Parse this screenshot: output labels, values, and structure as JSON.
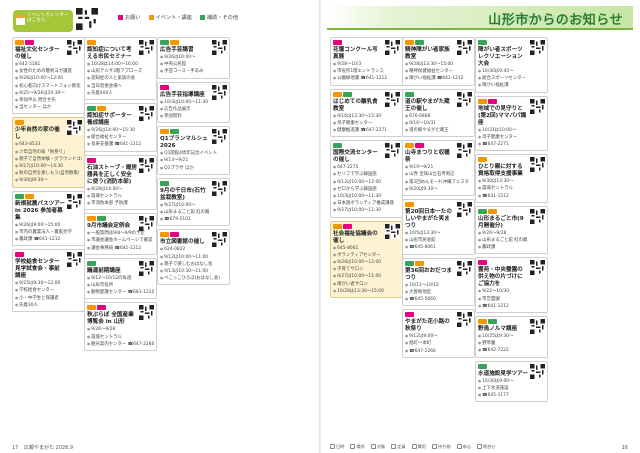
{
  "header": {
    "calendar_pill": "イベントカレンダーはこちら",
    "legend": [
      {
        "label": "お願い",
        "color": "#e4007f"
      },
      {
        "label": "イベント・講座",
        "color": "#f39800"
      },
      {
        "label": "補助・その他",
        "color": "#3aa35a"
      }
    ],
    "title": "山形市からのお知らせ"
  },
  "columns": [
    [
      {
        "title": "福祉文化センターの催し",
        "lines": [
          "642-5181",
          "女性のための簡易ヨガ講座",
          "9/26は10:00〜12:00",
          "初心者向けスマートフォン教室",
          "9/25〜9/26は10:30〜",
          "参加申込 問合せ先",
          "当センター ほか"
        ],
        "hl": false
      },
      {
        "title": "少年自然の家の催し",
        "lines": [
          "643-8533",
          "少年自然の家「秋祭り」",
          "親子で自然体験・グラウンドゴルフ",
          "9/27は10:00〜14:30",
          "秋の自然を楽しもう(自然散策)",
          "9/30は9:30〜"
        ],
        "hl": true
      },
      {
        "title": "新規就農パスツアー in 2026 参加者募集",
        "lines": [
          "9/26は9:00〜15:00",
          "市内の農業法人・農家見学",
          "農政課 ☎641-1212"
        ],
        "hl": false
      },
      {
        "title": "学校給食センター見学試食会・事前講座",
        "lines": [
          "9/25は9:30〜12:00",
          "学校給食センター",
          "小・中学生と保護者",
          "先着30人"
        ],
        "hl": false
      }
    ],
    [
      {
        "title": "認知症について考える市民セミナー",
        "lines": [
          "10/28は14:00〜16:00",
          "山形テルサ3階アプローズ",
          "認知症の人と家族の会",
          "当日直接会場へ",
          "先着400人"
        ],
        "hl": false
      },
      {
        "title": "認知症サポーター養成講座",
        "lines": [
          "9/26は14:00〜15:30",
          "総合福祉センター",
          "長寿支援課 ☎641-1212"
        ],
        "hl": false
      },
      {
        "title": "石油ストーブ・暖房器具を正しく安全に使う(消防本部)",
        "lines": [
          "9/28は14:00〜",
          "霞城セントラル",
          "市消防本部 予防課"
        ],
        "hl": false
      },
      {
        "title": "9月市議会定例会",
        "lines": [
          "一般質問は9/8〜9/9の予定",
          "市議会議会ホームページで確認",
          "議会事務局 ☎641-1212"
        ],
        "hl": false
      },
      {
        "title": "議運前期講座",
        "lines": [
          "9/12〜10/12の毎週",
          "山形市役所",
          "動物愛護センター ☎681-1210"
        ],
        "hl": false
      },
      {
        "title": "秋ぶらぼ 全国産業博覧会 in 山形",
        "lines": [
          "9/26〜9/28",
          "霞城セントラル",
          "観光案内センター ☎647-2266"
        ],
        "hl": false
      }
    ],
    [
      {
        "title": "広告手芸講習",
        "lines": [
          "9/26は10:00〜",
          "中央公民館",
          "手芸コース・手あみ"
        ],
        "hl": false
      },
      {
        "title": "広告手芸指導講座",
        "lines": [
          "10/3は10:00〜11:30",
          "広告作品展示",
          "参加無料"
        ],
        "hl": false
      },
      {
        "title": "Q1プランマルシェ 2026",
        "lines": [
          "Q1開館4周年記念イベント",
          "9/13〜9/21",
          "Q1プラザ ほか"
        ],
        "hl": false
      },
      {
        "title": "9月の千日市(石竹盆栽教室)",
        "lines": [
          "9/27は10:00〜",
          "山形まるごと館 紅の蔵",
          "☎679-5101"
        ],
        "hl": false
      },
      {
        "title": "市立図書館の催し",
        "lines": [
          "624-0822",
          "9/12は10:00〜11:00",
          "親子で楽しむおはなし会",
          "9/13は10:30〜11:00",
          "べこっこひろば(おはなし会)"
        ],
        "hl": false
      }
    ],
    [
      {
        "title": "花壇コンクール写真展",
        "lines": [
          "9/28〜10/3",
          "市役所1階エントランス",
          "公園緑地課 ☎641-1212"
        ],
        "hl": false
      },
      {
        "title": "はじめての離乳食教室",
        "lines": [
          "9/16は13:30〜15:30",
          "母子健康センター",
          "健康推進課 ☎647-2271"
        ],
        "hl": false
      },
      {
        "title": "国際交流センターの催し",
        "lines": [
          "647-2275",
          "セリフで学ぶ韓国語",
          "9/12は10:00〜12:00",
          "ゼロから学ぶ韓国語",
          "10/3は10:00〜11:30",
          "日本語ボランティア養成講座",
          "9/27は10:00〜11:30"
        ],
        "hl": false
      },
      {
        "title": "社会福祉協議会の催し",
        "lines": [
          "645-8061",
          "ボランティアセンター",
          "9/26は10:00〜12:00",
          "子育てサロン",
          "9/27は10:00〜11:00",
          "障がい者サロン",
          "10/28は13:30〜15:00"
        ],
        "hl": true
      }
    ],
    [
      {
        "title": "精神障がい者家族教室",
        "lines": [
          "9/28は13:30〜15:00",
          "精神保健福祉センター",
          "障がい福祉課 ☎641-1212"
        ],
        "hl": false
      },
      {
        "title": "道の駅やまがた蔵王の催し",
        "lines": [
          "676-6868",
          "9/16〜10/31",
          "道の駅やまがた蔵王"
        ],
        "hl": false
      },
      {
        "title": "山寺まつりと収穫祭",
        "lines": [
          "9/19〜9/21",
          "山寺 宝珠山立石寺周辺",
          "第2回めんそーれ沖縄フェスタ",
          "9/20は9:30〜"
        ],
        "hl": false
      },
      {
        "title": "第20回日本一たのしいやまがた笑まつり",
        "lines": [
          "10/5は13:30〜",
          "山形市民会館",
          "☎645-8061"
        ],
        "hl": false
      },
      {
        "title": "第36回おおだつまつり",
        "lines": [
          "10/11〜10/12",
          "大曽根地区",
          "☎645-5660"
        ],
        "hl": false
      },
      {
        "title": "やまがた花小路の秋祭り",
        "lines": [
          "9/12は9:00〜",
          "旭町〜本町",
          "☎647-2266"
        ],
        "hl": false
      }
    ],
    [
      {
        "title": "障がい者スポーツレクリエーション大会",
        "lines": [
          "10/30は9:45〜",
          "総合スポーツセンター",
          "障がい福祉課"
        ],
        "hl": false
      },
      {
        "title": "地域での見守りと(第2回)ママパパ講座",
        "lines": [
          "10/31は10:00〜",
          "母子健康センター",
          "☎647-2271"
        ],
        "hl": false
      },
      {
        "title": "ひとり親に対する資格取得支援事業",
        "lines": [
          "9/30は13:30〜",
          "霞城セントラル",
          "☎641-1212"
        ],
        "hl": false
      },
      {
        "title": "山形まるごと市(9月開催分)",
        "lines": [
          "9/26〜9/28",
          "山形まるごと館 紅の蔵",
          "農政課"
        ],
        "hl": false
      },
      {
        "title": "霊苑・中央霊園の供え物の片づけにご協力を",
        "lines": [
          "9/22〜10/30",
          "市営霊園",
          "☎641-1212"
        ],
        "hl": false
      },
      {
        "title": "野鳥ノルマ講座",
        "lines": [
          "10/25は9:30〜",
          "野草園",
          "☎642-7222"
        ],
        "hl": false
      },
      {
        "title": "水道施設見学ツアー",
        "lines": [
          "10/30は9:00〜",
          "上下水道施設",
          "☎645-1177"
        ],
        "hl": false
      }
    ]
  ],
  "footer": {
    "left_page": "17",
    "left_pub": "広報やまがた 2026.9",
    "right_page": "16",
    "icons": [
      "日時",
      "場所",
      "対象",
      "定員",
      "費用",
      "持ち物",
      "申込",
      "問合せ"
    ]
  }
}
